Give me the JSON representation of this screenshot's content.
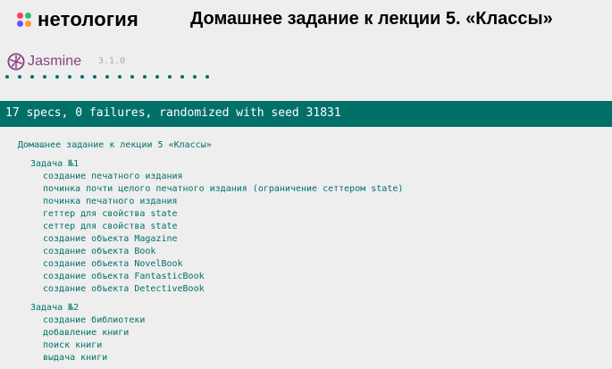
{
  "header": {
    "brand": "нетология",
    "title": "Домашнее задание к лекции 5. «Классы»"
  },
  "jasmine": {
    "name": "Jasmine",
    "version": "3.1.0",
    "spec_dot_count": 17
  },
  "summary": {
    "text": "17 specs, 0 failures, randomized with seed 31831",
    "color": "#007069"
  },
  "results": {
    "root_suite": "Домашнее задание к лекции 5 «Классы»",
    "suites": [
      {
        "name": "Задача №1",
        "specs": [
          "создание печатного издания",
          "починка почти целого печатного издания (ограничение сеттером state)",
          "починка печатного издания",
          "геттер для свойства state",
          "сеттер для свойства state",
          "создание объекта Magazine",
          "создание объекта Book",
          "создание объекта NovelBook",
          "создание объекта FantasticBook",
          "создание объекта DetectiveBook"
        ]
      },
      {
        "name": "Задача №2",
        "specs": [
          "создание библиотеки",
          "добавление книги",
          "поиск книги",
          "выдача книги"
        ]
      }
    ]
  },
  "colors": {
    "jasmine_purple": "#8a4182",
    "passing_green": "#007069",
    "background": "#eeeeee"
  }
}
